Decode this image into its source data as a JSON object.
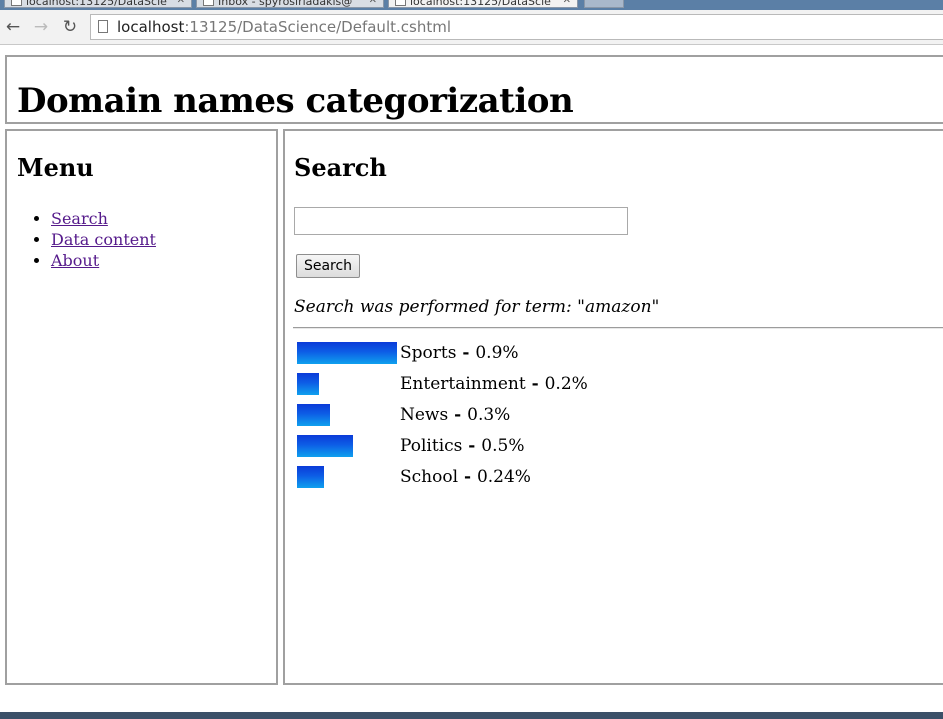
{
  "browser": {
    "tabs": [
      {
        "label": "localhost:13125/DataScie",
        "active": false
      },
      {
        "label": "Inbox - spyrosiriadakis@",
        "active": false
      },
      {
        "label": "localhost:13125/DataScie",
        "active": true
      }
    ],
    "url_host": "localhost",
    "url_path": ":13125/DataScience/Default.cshtml"
  },
  "header": {
    "title": "Domain names categorization"
  },
  "menu": {
    "title": "Menu",
    "items": [
      {
        "label": "Search"
      },
      {
        "label": "Data content"
      },
      {
        "label": "About"
      }
    ]
  },
  "main": {
    "title": "Search",
    "search_value": "",
    "search_button": "Search",
    "result_note": "Search was performed for term: \"amazon\""
  },
  "chart_data": {
    "type": "bar",
    "categories": [
      "Sports",
      "Entertainment",
      "News",
      "Politics",
      "School"
    ],
    "values": [
      0.9,
      0.2,
      0.3,
      0.5,
      0.24
    ],
    "value_labels": [
      "0.9%",
      "0.2%",
      "0.3%",
      "0.5%",
      "0.24%"
    ],
    "separator": "-",
    "orientation": "horizontal",
    "bar_color_top": "#0b3bd8",
    "bar_color_bottom": "#0fa0ee"
  }
}
